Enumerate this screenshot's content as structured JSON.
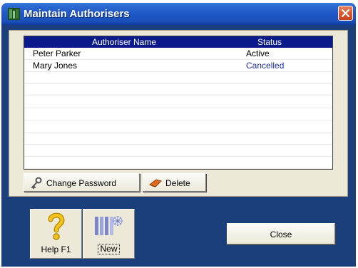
{
  "window": {
    "title": "Maintain Authorisers"
  },
  "grid": {
    "columns": {
      "name": "Authoriser Name",
      "status": "Status"
    },
    "rows": [
      {
        "name": "Peter Parker",
        "status": "Active",
        "status_color": "#000000"
      },
      {
        "name": "Mary Jones",
        "status": "Cancelled",
        "status_color": "#1a2f9e"
      }
    ]
  },
  "buttons": {
    "change_password": "Change Password",
    "delete": "Delete",
    "help": "Help F1",
    "new": "New",
    "close": "Close"
  },
  "icons": {
    "app": "app-icon",
    "close": "close-icon",
    "change_password": "key-icon",
    "delete": "eraser-icon",
    "help": "question-mark-icon",
    "new": "new-document-icon"
  },
  "colors": {
    "titlebar": "#1f58c6",
    "window_bg": "#1a3f7a",
    "grid_header": "#0a1a8a",
    "panel_bg": "#ece9d8"
  }
}
